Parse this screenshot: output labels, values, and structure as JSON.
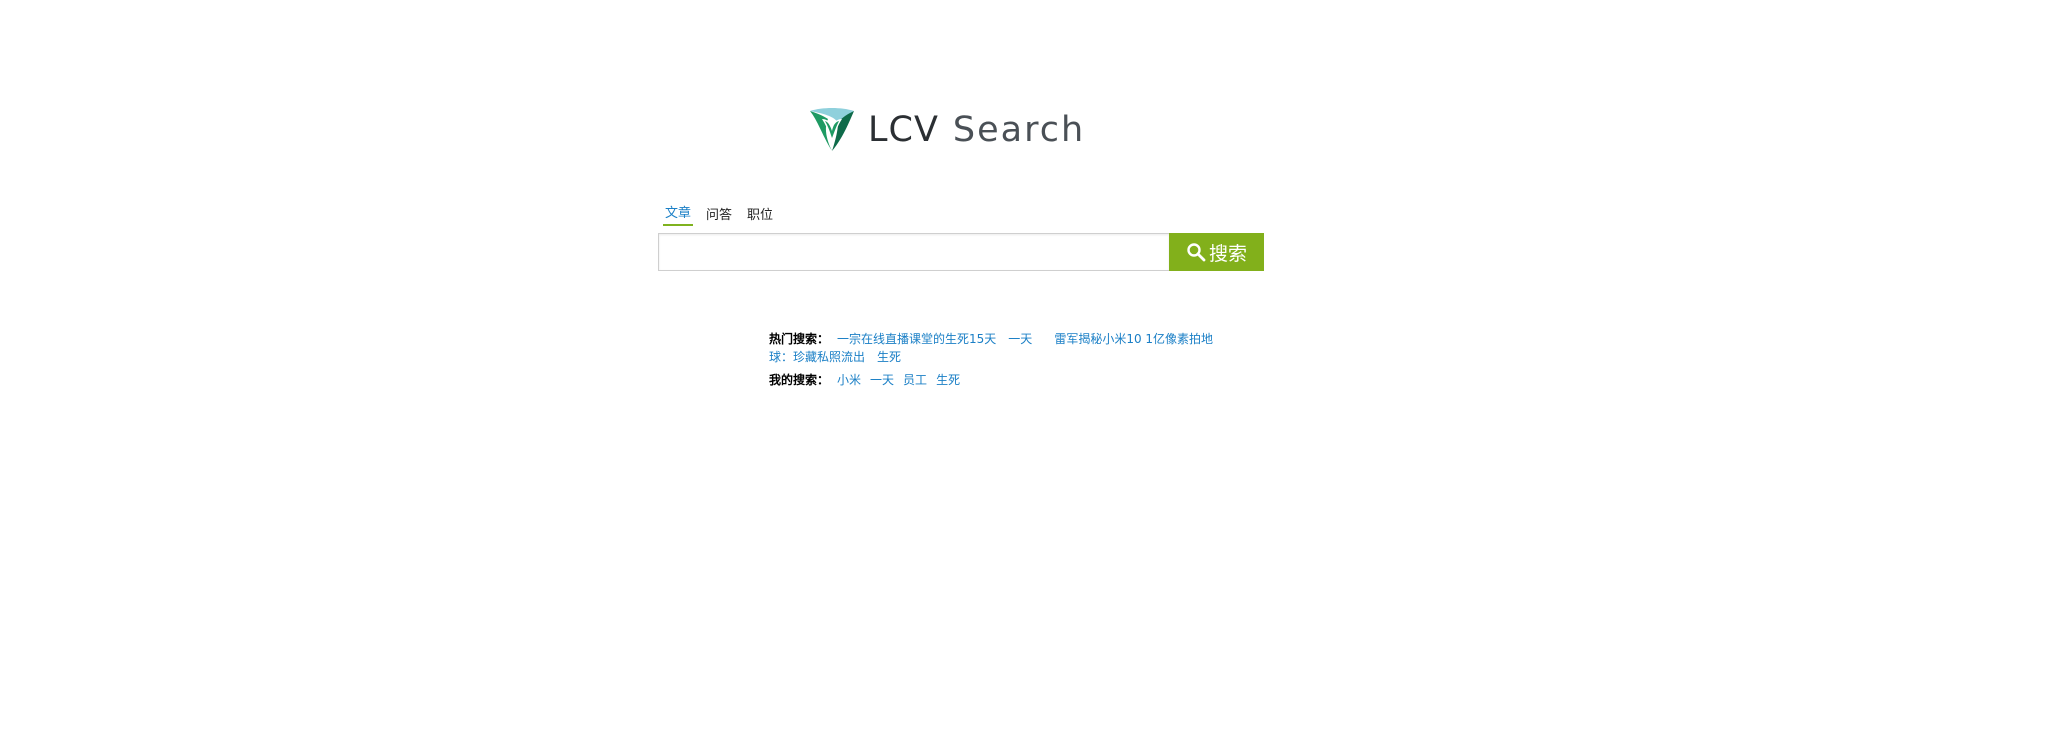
{
  "logo": {
    "brand": "LCV",
    "product": "Search",
    "colors": {
      "dark_green": "#0f6b4a",
      "green": "#1e9a63",
      "light_blue": "#8fd0dc",
      "text": "#2b2f33"
    }
  },
  "tabs": [
    {
      "label": "文章",
      "active": true
    },
    {
      "label": "问答",
      "active": false
    },
    {
      "label": "职位",
      "active": false
    }
  ],
  "search": {
    "value": "",
    "placeholder": "",
    "button_label": "搜索",
    "button_color": "#82b01b",
    "icon": "search-icon"
  },
  "hot_searches": {
    "label": "热门搜索：",
    "items": [
      "一宗在线直播课堂的生死15天",
      "一天",
      "雷军揭秘小米10 1亿像素拍地球：珍藏私照流出",
      "生死"
    ]
  },
  "my_searches": {
    "label": "我的搜索：",
    "items": [
      "小米",
      "一天",
      "员工",
      "生死"
    ]
  },
  "colors": {
    "link": "#1a7fc6",
    "active_tab_underline": "#7fb21f"
  }
}
